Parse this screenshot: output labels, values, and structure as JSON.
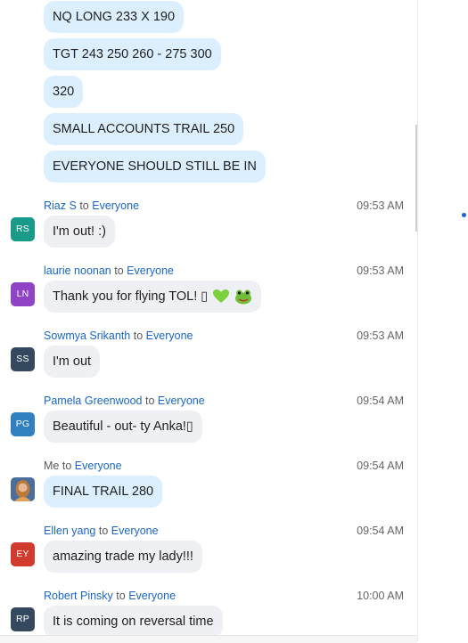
{
  "group_messages": [
    "NQ LONG 233 X 190",
    "TGT 243 250 260 - 275 300",
    "320",
    "SMALL ACCOUNTS TRAIL 250",
    "EVERYONE SHOULD STILL BE IN"
  ],
  "to_label": "to",
  "everyone_label": "Everyone",
  "messages": [
    {
      "sender": "Riaz S",
      "initials": "RS",
      "avatar_color": "#1a9b8a",
      "time": "09:53 AM",
      "text": "I'm out! :)"
    },
    {
      "sender": "laurie noonan",
      "initials": "LN",
      "avatar_color": "#8e44c4",
      "time": "09:53 AM",
      "text": "Thank you for flying TOL! ▯",
      "emojis": [
        "green-heart-icon",
        "frog-icon"
      ]
    },
    {
      "sender": "Sowmya Srikanth",
      "initials": "SS",
      "avatar_color": "#34495e",
      "time": "09:53 AM",
      "text": "I'm out"
    },
    {
      "sender": "Pamela Greenwood",
      "initials": "PG",
      "avatar_color": "#2f7fc1",
      "time": "09:54 AM",
      "text": "Beautiful - out- ty Anka!▯"
    },
    {
      "sender": "Me",
      "initials": "",
      "avatar_color": "#5a7fb0",
      "time": "09:54 AM",
      "text": "FINAL TRAIL 280"
    },
    {
      "sender": "Ellen yang",
      "initials": "EY",
      "avatar_color": "#d13b2e",
      "time": "09:54 AM",
      "text": "amazing trade my lady!!!"
    },
    {
      "sender": "Robert Pinsky",
      "initials": "RP",
      "avatar_color": "#34495e",
      "time": "10:00 AM",
      "text": "It is coming on reversal time"
    }
  ]
}
